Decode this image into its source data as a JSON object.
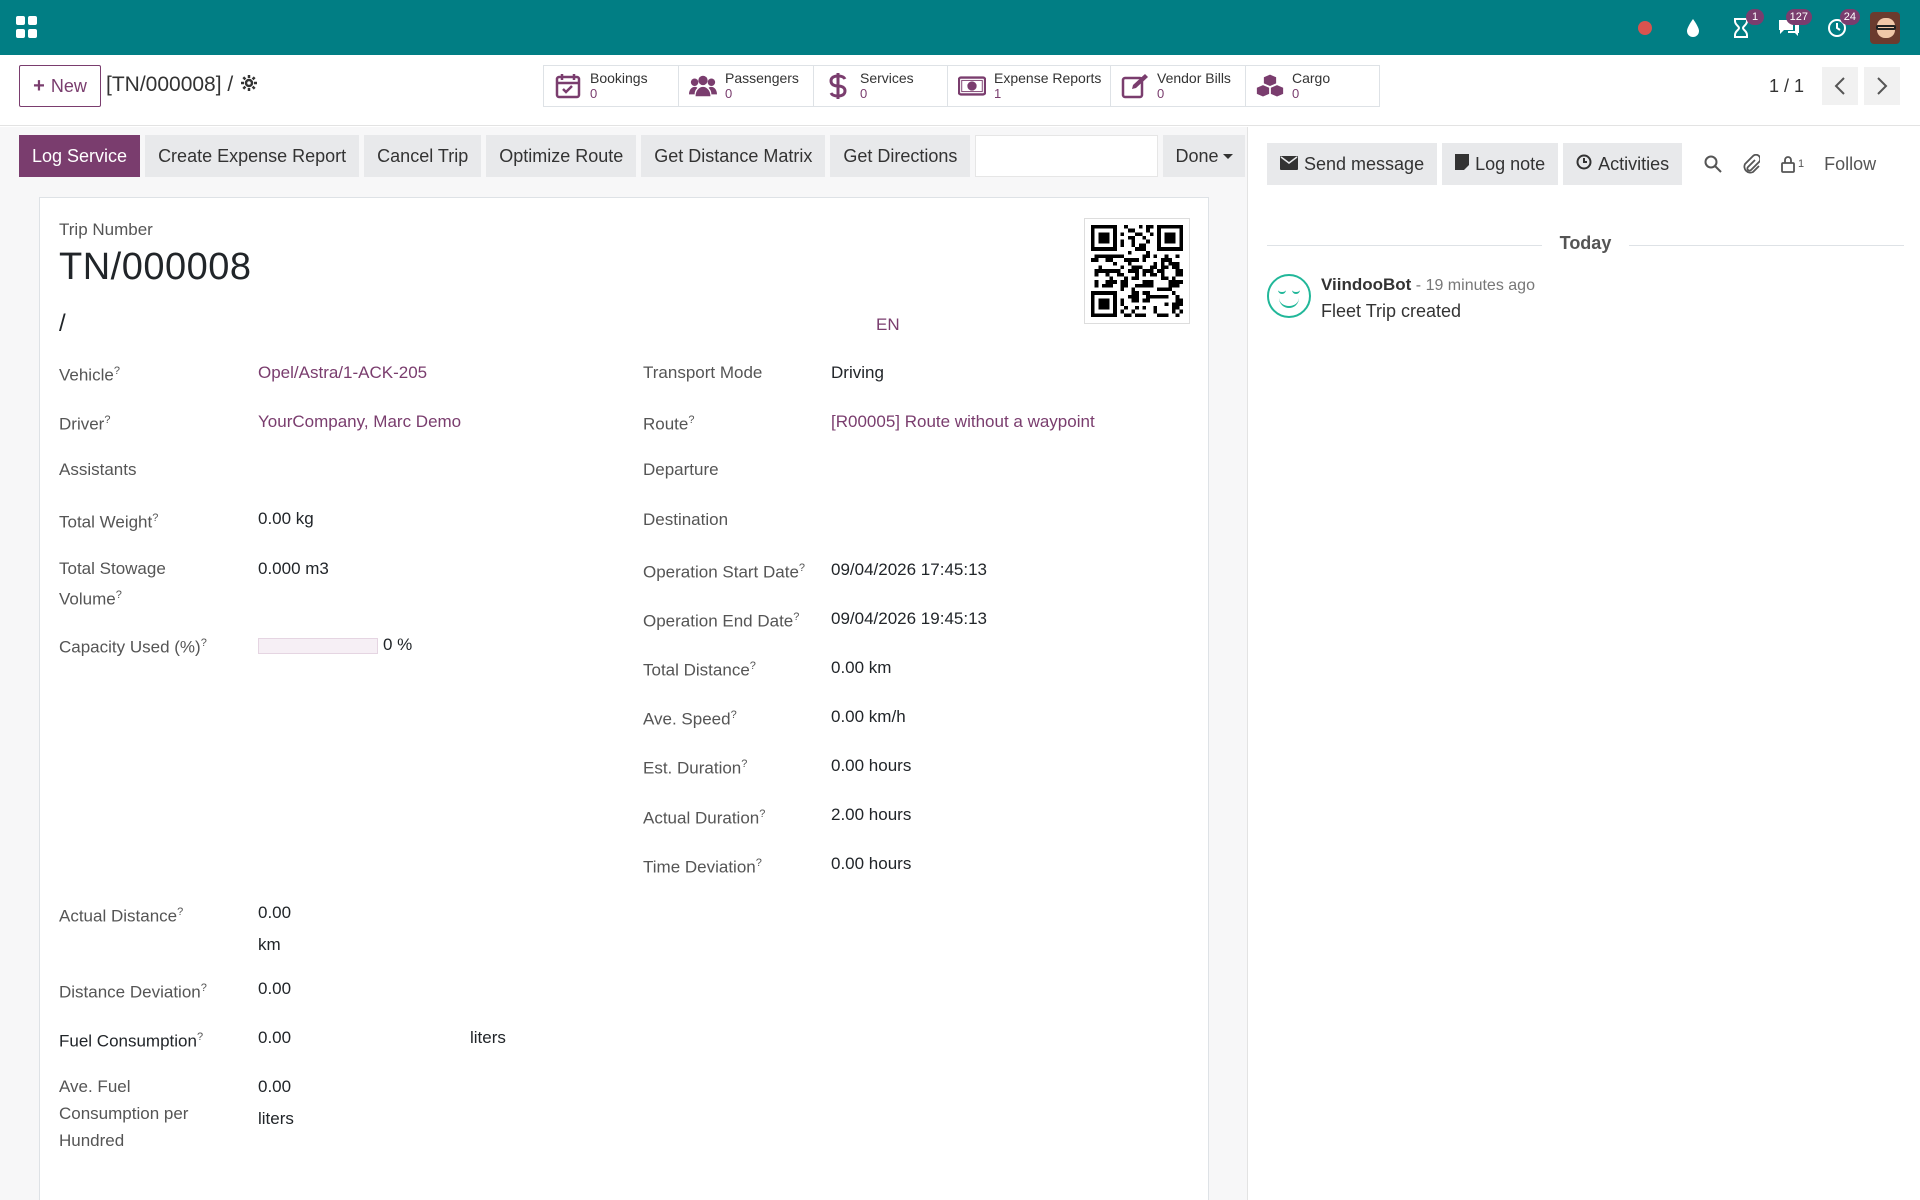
{
  "colors": {
    "brand": "#017e84",
    "accent": "#7a3d6e",
    "badge": "#7a3d6e"
  },
  "topbar": {
    "icons": [
      "apps-icon",
      "record-dot-icon",
      "droplet-icon",
      "hourglass-icon",
      "chat-bubbles-icon",
      "clock-icon",
      "user-avatar"
    ],
    "badges": {
      "hourglass": "1",
      "chat": "127",
      "clock": "24"
    }
  },
  "control": {
    "new_label": "New",
    "breadcrumb": "[TN/000008] /",
    "smart_buttons": [
      {
        "label": "Bookings",
        "value": "0",
        "icon": "calendar-check-icon"
      },
      {
        "label": "Passengers",
        "value": "0",
        "icon": "users-icon"
      },
      {
        "label": "Services",
        "value": "0",
        "icon": "dollar-icon"
      },
      {
        "label": "Expense Reports",
        "value": "1",
        "icon": "money-bill-icon"
      },
      {
        "label": "Vendor Bills",
        "value": "0",
        "icon": "edit-icon"
      },
      {
        "label": "Cargo",
        "value": "0",
        "icon": "cubes-icon"
      }
    ],
    "pager": "1 / 1"
  },
  "statusbar": {
    "buttons": [
      "Log Service",
      "Create Expense Report",
      "Cancel Trip",
      "Optimize Route",
      "Get Distance Matrix",
      "Get Directions"
    ],
    "done_label": "Done"
  },
  "form": {
    "trip_label": "Trip Number",
    "trip_title": "TN/000008",
    "slash": "/",
    "lang": "EN",
    "left_fields": {
      "vehicle": {
        "label": "Vehicle",
        "value": "Opel/Astra/1-ACK-205"
      },
      "driver": {
        "label": "Driver",
        "value": "YourCompany, Marc Demo"
      },
      "assistants": {
        "label": "Assistants"
      },
      "total_weight": {
        "label": "Total Weight",
        "value": "0.00 kg"
      },
      "stowage_1": {
        "label": "Total Stowage"
      },
      "stowage_2": {
        "label": "Volume"
      },
      "stowage_value": "0.000 m3",
      "capacity": {
        "label": "Capacity Used (%)",
        "value": "0 %",
        "fraction": 0
      },
      "actual_distance": {
        "label": "Actual Distance",
        "value": "0.00",
        "unit": "km"
      },
      "distance_deviation": {
        "label": "Distance Deviation",
        "value": "0.00"
      },
      "fuel": {
        "label": "Fuel Consumption",
        "value": "0.00",
        "unit": "liters"
      },
      "ave_fuel_1": "Ave. Fuel",
      "ave_fuel_2": "Consumption per",
      "ave_fuel_3": "Hundred",
      "ave_fuel_value": "0.00",
      "ave_fuel_unit": "liters"
    },
    "right_fields": {
      "transport_mode": {
        "label": "Transport Mode",
        "value": "Driving"
      },
      "route": {
        "label": "Route",
        "value": "[R00005] Route without a waypoint"
      },
      "departure": {
        "label": "Departure"
      },
      "destination": {
        "label": "Destination"
      },
      "op_start": {
        "label": "Operation Start Date",
        "value": "09/04/2026 17:45:13"
      },
      "op_end": {
        "label": "Operation End Date",
        "value": "09/04/2026 19:45:13"
      },
      "total_distance": {
        "label": "Total Distance",
        "value": "0.00 km"
      },
      "ave_speed": {
        "label": "Ave. Speed",
        "value": "0.00 km/h"
      },
      "est_duration": {
        "label": "Est. Duration",
        "value": "0.00 hours"
      },
      "actual_duration": {
        "label": "Actual Duration",
        "value": "2.00 hours"
      },
      "time_deviation": {
        "label": "Time Deviation",
        "value": "0.00 hours"
      }
    },
    "help_mark": "?"
  },
  "chatter": {
    "send_message": "Send message",
    "log_note": "Log note",
    "activities": "Activities",
    "followers_count": "1",
    "follow": "Follow",
    "today": "Today",
    "message": {
      "author": "ViindooBot",
      "time": " - 19 minutes ago",
      "body": "Fleet Trip created"
    }
  }
}
